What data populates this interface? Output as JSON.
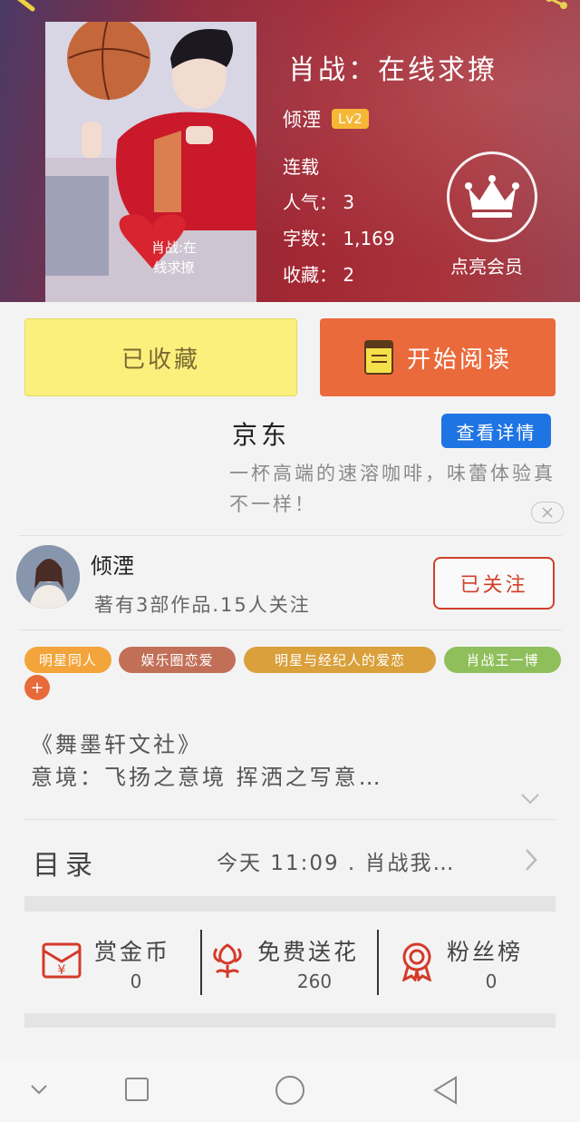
{
  "book": {
    "title": "肖战：在线求撩",
    "author": "倾湮",
    "level": "Lv2",
    "status": "连载",
    "popularity": "人气： 3",
    "word_count": "字数： 1,169",
    "favorites": "收藏： 2",
    "cover_caption_line1": "肖战:在",
    "cover_caption_line2": "线求撩"
  },
  "vip": {
    "label": "点亮会员",
    "icon": "crown-icon"
  },
  "actions": {
    "favorited_label": "已收藏",
    "read_label": "开始阅读"
  },
  "ad": {
    "brand": "京东",
    "detail_button": "查看详情",
    "text": "一杯高端的速溶咖啡，味蕾体验真不一样！"
  },
  "author_card": {
    "name": "倾湮",
    "stats": "著有3部作品.15人关注",
    "follow_label": "已关注"
  },
  "tags": [
    {
      "label": "明星同人",
      "color": "#f3a43a"
    },
    {
      "label": "娱乐圈恋爱",
      "color": "#c26f58"
    },
    {
      "label": "明星与经纪人的爱恋",
      "color": "#d9a03b"
    },
    {
      "label": "肖战王一博",
      "color": "#8fbf5a"
    }
  ],
  "tag_add": "+",
  "description": {
    "line1": "《舞墨轩文社》",
    "line2": "意境：飞扬之意境 挥洒之写意…"
  },
  "toc": {
    "title": "目录",
    "latest": "今天 11:09 . 肖战我…"
  },
  "stats": [
    {
      "label": "赏金币",
      "value": "0",
      "icon": "red-envelope-icon"
    },
    {
      "label": "免费送花",
      "value": "260",
      "icon": "flower-icon"
    },
    {
      "label": "粉丝榜",
      "value": "0",
      "icon": "medal-icon"
    }
  ],
  "colors": {
    "accent": "#ea6a3b",
    "favorited": "#fbf07c",
    "link": "#1f74e3",
    "icon_red": "#d43a2a"
  }
}
